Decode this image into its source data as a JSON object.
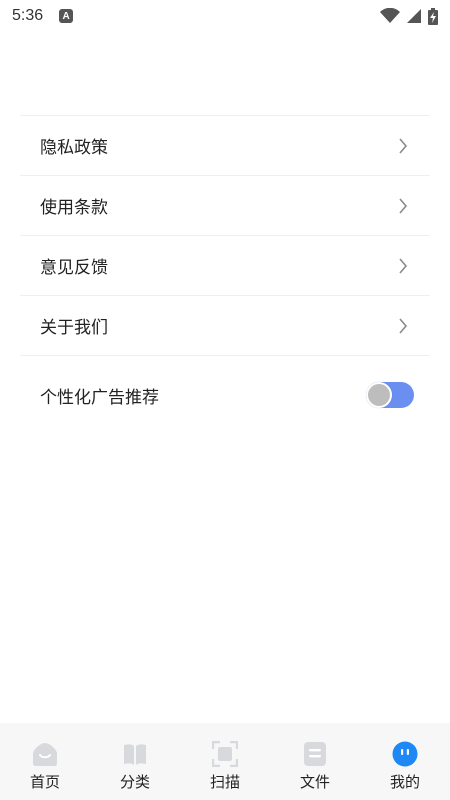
{
  "status_bar": {
    "time": "5:36",
    "notification_letter": "A",
    "icons": [
      "wifi-icon",
      "signal-icon",
      "battery-charging-icon"
    ]
  },
  "settings": {
    "items": [
      {
        "label": "隐私政策",
        "icon": "chevron-right-icon"
      },
      {
        "label": "使用条款",
        "icon": "chevron-right-icon"
      },
      {
        "label": "意见反馈",
        "icon": "chevron-right-icon"
      },
      {
        "label": "关于我们",
        "icon": "chevron-right-icon"
      }
    ],
    "personalized_ads": {
      "label": "个性化广告推荐",
      "enabled": true
    }
  },
  "bottom_nav": {
    "active_index": 4,
    "items": [
      {
        "label": "首页",
        "icon": "home-icon"
      },
      {
        "label": "分类",
        "icon": "book-icon"
      },
      {
        "label": "扫描",
        "icon": "scan-icon"
      },
      {
        "label": "文件",
        "icon": "file-icon"
      },
      {
        "label": "我的",
        "icon": "profile-icon"
      }
    ]
  },
  "colors": {
    "accent": "#6b8ff0",
    "active_tab": "#1e88f5",
    "inactive_icon": "#d7d9dd",
    "divider": "#efefef",
    "nav_background": "#f7f7f7"
  }
}
